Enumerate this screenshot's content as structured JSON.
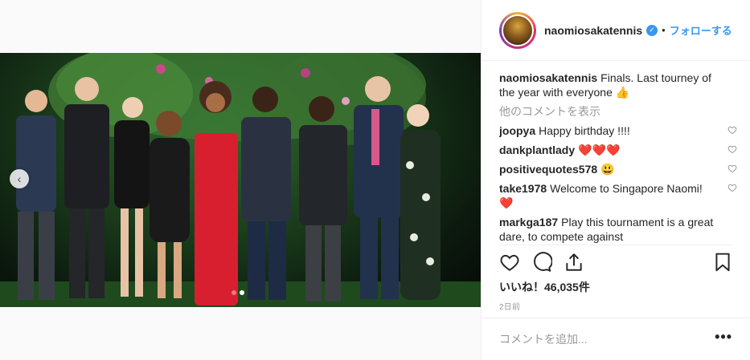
{
  "header": {
    "username": "naomiosakatennis",
    "follow_label": "フォローする"
  },
  "caption": {
    "username": "naomiosakatennis",
    "text": "Finals. Last tourney of the year with everyone 👍"
  },
  "more_comments_label": "他のコメントを表示",
  "comments": [
    {
      "user": "joopya",
      "text": "Happy birthday !!!!"
    },
    {
      "user": "dankplantlady",
      "text": "❤️❤️❤️"
    },
    {
      "user": "positivequotes578",
      "text": "😃"
    },
    {
      "user": "take1978",
      "text": "Welcome to Singapore Naomi! ❤️"
    },
    {
      "user": "markga187",
      "text": "Play this tournament is a great dare, to compete against"
    }
  ],
  "likes_label": "いいね！46,035件",
  "timestamp": "2日前",
  "add_comment_placeholder": "コメントを追加...",
  "options_label": "•••",
  "colors": {
    "accent": "#3897f0",
    "text": "#262626",
    "muted": "#999999",
    "border": "#efefef"
  },
  "icons": [
    "chevron-left-icon",
    "verified-icon",
    "heart-icon",
    "comment-icon",
    "share-icon",
    "bookmark-icon"
  ]
}
